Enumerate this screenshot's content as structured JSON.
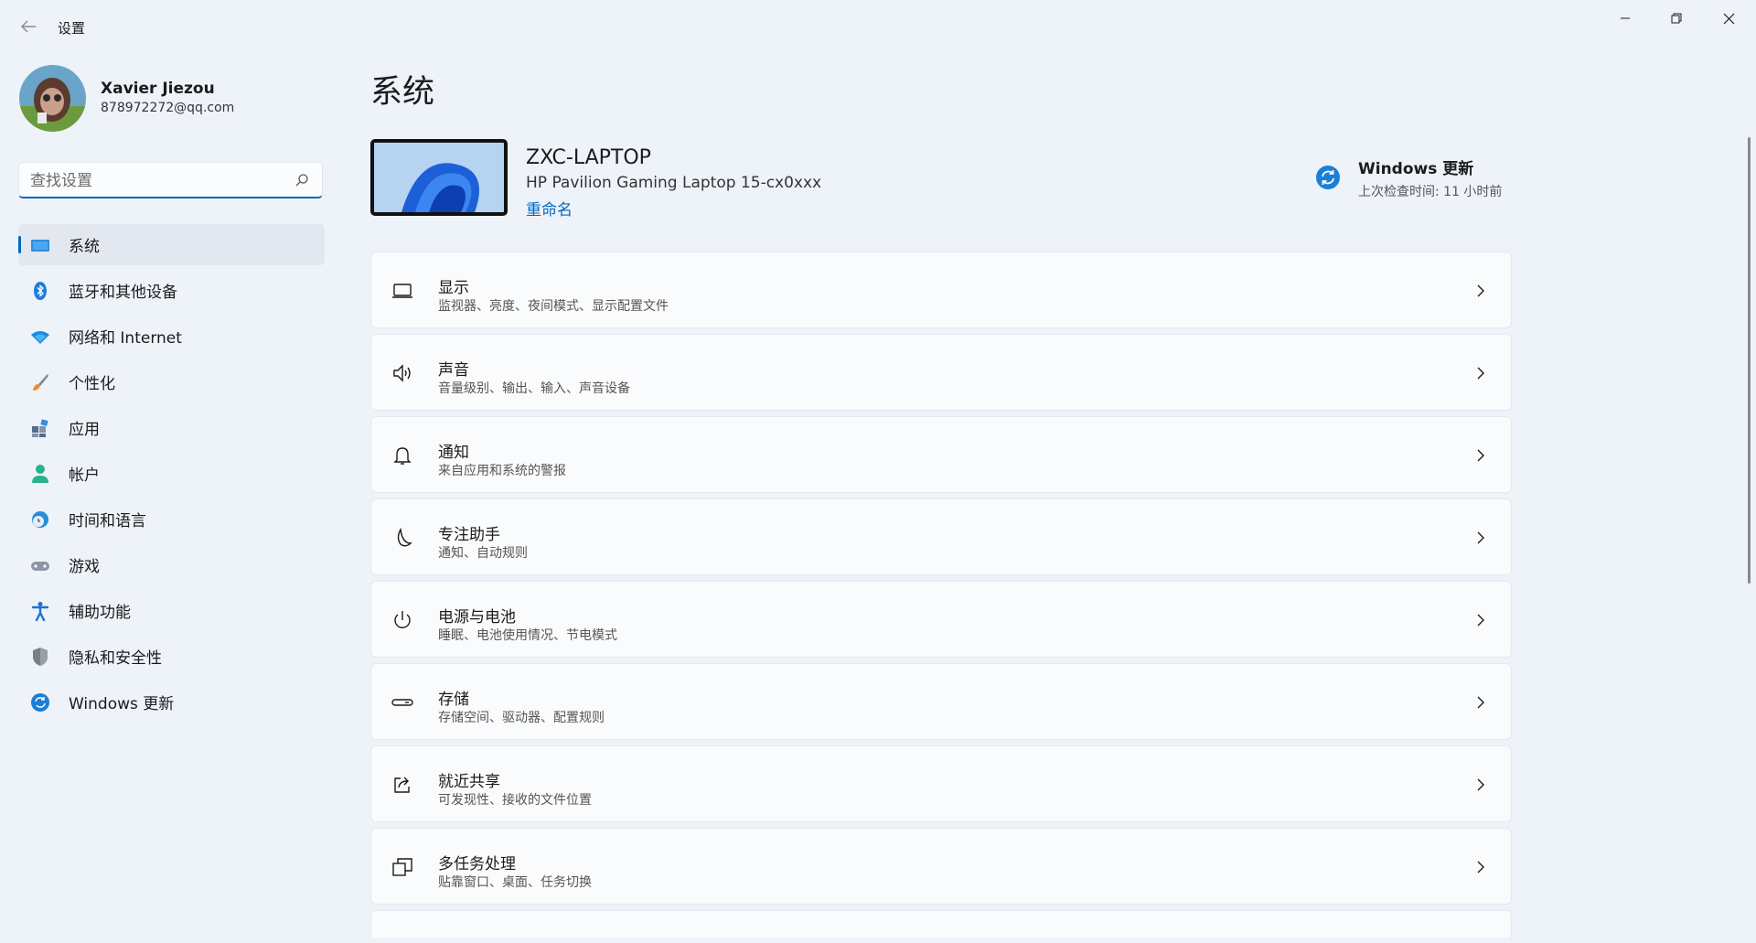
{
  "app": {
    "title": "设置"
  },
  "profile": {
    "name": "Xavier Jiezou",
    "email": "878972272@qq.com"
  },
  "search": {
    "placeholder": "查找设置"
  },
  "sidebar": {
    "items": [
      {
        "label": "系统",
        "icon": "monitor-icon",
        "active": true
      },
      {
        "label": "蓝牙和其他设备",
        "icon": "bluetooth-icon"
      },
      {
        "label": "网络和 Internet",
        "icon": "wifi-icon"
      },
      {
        "label": "个性化",
        "icon": "brush-icon"
      },
      {
        "label": "应用",
        "icon": "apps-icon"
      },
      {
        "label": "帐户",
        "icon": "person-icon"
      },
      {
        "label": "时间和语言",
        "icon": "globe-clock-icon"
      },
      {
        "label": "游戏",
        "icon": "gamepad-icon"
      },
      {
        "label": "辅助功能",
        "icon": "accessibility-icon"
      },
      {
        "label": "隐私和安全性",
        "icon": "shield-icon"
      },
      {
        "label": "Windows 更新",
        "icon": "sync-icon"
      }
    ]
  },
  "main": {
    "title": "系统",
    "device": {
      "name": "ZXC-LAPTOP",
      "model": "HP Pavilion Gaming Laptop 15-cx0xxx",
      "rename_label": "重命名"
    },
    "windows_update": {
      "title": "Windows 更新",
      "subtitle": "上次检查时间: 11 小时前"
    },
    "cards": [
      {
        "title": "显示",
        "subtitle": "监视器、亮度、夜间模式、显示配置文件",
        "icon": "display-icon"
      },
      {
        "title": "声音",
        "subtitle": "音量级别、输出、输入、声音设备",
        "icon": "speaker-icon"
      },
      {
        "title": "通知",
        "subtitle": "来自应用和系统的警报",
        "icon": "bell-icon"
      },
      {
        "title": "专注助手",
        "subtitle": "通知、自动规则",
        "icon": "moon-icon"
      },
      {
        "title": "电源与电池",
        "subtitle": "睡眠、电池使用情况、节电模式",
        "icon": "power-icon"
      },
      {
        "title": "存储",
        "subtitle": "存储空间、驱动器、配置规则",
        "icon": "storage-icon"
      },
      {
        "title": "就近共享",
        "subtitle": "可发现性、接收的文件位置",
        "icon": "share-icon"
      },
      {
        "title": "多任务处理",
        "subtitle": "贴靠窗口、桌面、任务切换",
        "icon": "multitask-icon"
      }
    ]
  },
  "colors": {
    "accent": "#0067c0",
    "background": "#eef2f9",
    "card": "#f9fbfd"
  }
}
